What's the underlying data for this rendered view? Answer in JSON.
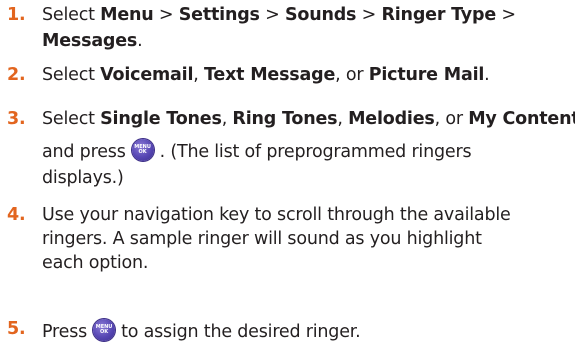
{
  "key_icon": {
    "top": "MENU",
    "bottom": "OK"
  },
  "steps": [
    {
      "number": "1.",
      "lines": [
        [
          {
            "t": "Select ",
            "b": false
          },
          {
            "t": "Menu",
            "b": true
          },
          {
            "t": " > ",
            "b": false
          },
          {
            "t": "Settings",
            "b": true
          },
          {
            "t": " > ",
            "b": false
          },
          {
            "t": "Sounds",
            "b": true
          },
          {
            "t": " > ",
            "b": false
          },
          {
            "t": "Ringer Type",
            "b": true
          },
          {
            "t": " >",
            "b": false
          }
        ],
        [
          {
            "t": "Messages",
            "b": true
          },
          {
            "t": ".",
            "b": false
          }
        ]
      ]
    },
    {
      "number": "2.",
      "lines": [
        [
          {
            "t": "Select ",
            "b": false
          },
          {
            "t": "Voicemail",
            "b": true
          },
          {
            "t": ", ",
            "b": false
          },
          {
            "t": "Text Message",
            "b": true
          },
          {
            "t": ", or ",
            "b": false
          },
          {
            "t": "Picture Mail",
            "b": true
          },
          {
            "t": ".",
            "b": false
          }
        ]
      ]
    },
    {
      "number": "3.",
      "lines": [
        [
          {
            "t": "Select ",
            "b": false
          },
          {
            "t": "Single Tones",
            "b": true
          },
          {
            "t": ", ",
            "b": false
          },
          {
            "t": "Ring Tones",
            "b": true
          },
          {
            "t": ", ",
            "b": false
          },
          {
            "t": "Melodies",
            "b": true
          },
          {
            "t": ", or ",
            "b": false
          },
          {
            "t": "My Content",
            "b": true
          }
        ],
        [
          {
            "t": "and press",
            "b": false
          },
          {
            "icon": "menu-ok-key-icon"
          },
          {
            "t": ". (The list of preprogrammed ringers",
            "b": false
          }
        ],
        [
          {
            "t": "displays.)",
            "b": false
          }
        ]
      ]
    },
    {
      "number": "4.",
      "lines": [
        [
          {
            "t": "Use your navigation key to scroll through the available",
            "b": false
          }
        ],
        [
          {
            "t": "ringers. A sample ringer will sound as you highlight",
            "b": false
          }
        ],
        [
          {
            "t": "each option.",
            "b": false
          }
        ]
      ]
    },
    {
      "number": "5.",
      "lines": [
        [
          {
            "t": "Press",
            "b": false
          },
          {
            "icon": "menu-ok-key-icon"
          },
          {
            "t": "to assign the desired ringer.",
            "b": false
          }
        ]
      ]
    }
  ]
}
